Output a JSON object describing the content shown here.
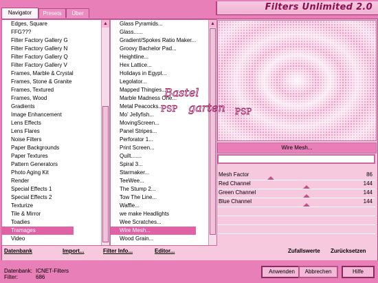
{
  "window": {
    "title": "Filters Unlimited 2.0"
  },
  "tabs": [
    {
      "label": "Navigator",
      "active": true
    },
    {
      "label": "Presets",
      "active": false
    },
    {
      "label": "Über",
      "active": false
    }
  ],
  "categories": {
    "items": [
      "Edges, Square",
      "FFG???",
      "Filter Factory Gallery G",
      "Filter Factory Gallery N",
      "Filter Factory Gallery Q",
      "Filter Factory Gallery V",
      "Frames, Marble & Crystal",
      "Frames, Stone & Granite",
      "Frames, Textured",
      "Frames, Wood",
      "Gradients",
      "Image Enhancement",
      "Lens Effects",
      "Lens Flares",
      "Noise Filters",
      "Paper Backgrounds",
      "Paper Textures",
      "Pattern Generators",
      "Photo Aging Kit",
      "Render",
      "Special Effects 1",
      "Special Effects 2",
      "Texturize",
      "Tile & Mirror",
      "Toadies",
      "Tramages",
      "Video"
    ],
    "selected": "Tramages"
  },
  "filters": {
    "items": [
      "Glass Pyramids...",
      "Glass......",
      "Gradient/Spokes Ratio Maker...",
      "Groovy Bachelor Pad...",
      "Heightline...",
      "Hex Lattice...",
      "Holidays in Egypt...",
      "Legolator...",
      "Mapped Thingies...",
      "Marble Madness One...",
      "Metal Peacocks...",
      "Mo' Jellyfish...",
      "MovingScreen...",
      "Panel Stripes...",
      "Perforator 1...",
      "Print Screen...",
      "Quilt.......",
      "Spiral 3...",
      "Starmaker...",
      "TeeWee...",
      "The Stump 2...",
      "Tow The Line...",
      "Waffle...",
      "we make Headlights",
      "Wee Scratches...",
      "Wire Mesh...",
      "Wood Grain..."
    ],
    "selected": "Wire Mesh..."
  },
  "left_buttons": {
    "database": "Datenbank",
    "import": "Import...",
    "filter_info": "Filter Info...",
    "editor": "Editor..."
  },
  "filter_name": "Wire Mesh...",
  "parameters": [
    {
      "label": "Mesh Factor",
      "value": "86",
      "fraction": 0.337
    },
    {
      "label": "Red Channel",
      "value": "144",
      "fraction": 0.565
    },
    {
      "label": "Green Channel",
      "value": "144",
      "fraction": 0.565
    },
    {
      "label": "Blue Channel",
      "value": "144",
      "fraction": 0.565
    }
  ],
  "right_buttons": {
    "random": "Zufallswerte",
    "reset": "Zurücksetzen"
  },
  "footer": {
    "database_label": "Datenbank:",
    "database_value": "ICNET-Filters",
    "filter_label": "Filter:",
    "filter_value": "686",
    "apply": "Anwenden",
    "cancel": "Abbrechen",
    "help": "Hilfe"
  },
  "colors": {
    "accent": "#e87fb8",
    "selected": "#e062a4",
    "panel": "#f7c9df"
  }
}
